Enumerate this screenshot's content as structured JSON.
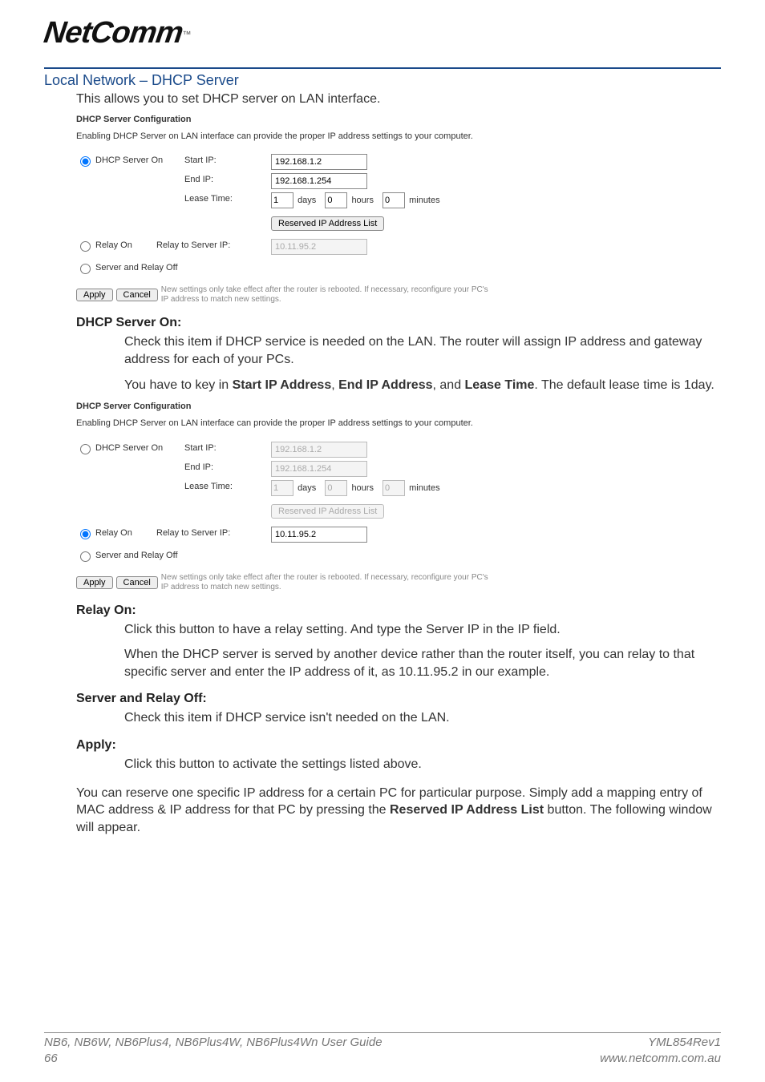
{
  "logo": {
    "brand": "NetComm",
    "tm": "™"
  },
  "section_title": "Local Network – DHCP Server",
  "intro": "This allows you to set DHCP server on LAN interface.",
  "panel1": {
    "title": "DHCP Server Configuration",
    "desc": "Enabling DHCP Server on LAN interface can provide the proper IP address settings to your computer.",
    "radio_dhcp_on": "DHCP Server On",
    "start_ip_label": "Start IP:",
    "start_ip": "192.168.1.2",
    "end_ip_label": "End IP:",
    "end_ip": "192.168.1.254",
    "lease_label": "Lease Time:",
    "days_val": "1",
    "days_lbl": "days",
    "hours_val": "0",
    "hours_lbl": "hours",
    "mins_val": "0",
    "mins_lbl": "minutes",
    "reserved_btn": "Reserved IP Address List",
    "radio_relay_on": "Relay On",
    "relay_ip_label": "Relay to Server IP:",
    "relay_ip": "10.11.95.2",
    "radio_off": "Server and Relay Off",
    "apply": "Apply",
    "cancel": "Cancel",
    "note": "New settings only take effect after the router is rebooted. If necessary, reconfigure your PC's IP address to match new settings."
  },
  "h_dhcp_on": "DHCP Server On:",
  "p_dhcp_on_1": "Check this item if DHCP service is needed on the LAN. The router will assign IP address and gateway address for each of your PCs.",
  "p_dhcp_on_2_pre": "You have to key in ",
  "p_dhcp_on_2_b1": "Start IP Address",
  "p_dhcp_on_2_mid1": ", ",
  "p_dhcp_on_2_b2": "End IP Address",
  "p_dhcp_on_2_mid2": ", and ",
  "p_dhcp_on_2_b3": "Lease Time",
  "p_dhcp_on_2_post": ". The default lease time is 1day.",
  "panel2": {
    "title": "DHCP Server Configuration",
    "desc": "Enabling DHCP Server on LAN interface can provide the proper IP address settings to your computer.",
    "radio_dhcp_on": "DHCP Server On",
    "start_ip_label": "Start IP:",
    "start_ip": "192.168.1.2",
    "end_ip_label": "End IP:",
    "end_ip": "192.168.1.254",
    "lease_label": "Lease Time:",
    "days_val": "1",
    "days_lbl": "days",
    "hours_val": "0",
    "hours_lbl": "hours",
    "mins_val": "0",
    "mins_lbl": "minutes",
    "reserved_btn": "Reserved IP Address List",
    "radio_relay_on": "Relay On",
    "relay_ip_label": "Relay to Server IP:",
    "relay_ip": "10.11.95.2",
    "radio_off": "Server and Relay Off",
    "apply": "Apply",
    "cancel": "Cancel",
    "note": "New settings only take effect after the router is rebooted. If necessary, reconfigure your PC's IP address to match new settings."
  },
  "h_relay_on": "Relay On:",
  "p_relay_on_1": "Click this button to have a relay setting. And type the Server IP in the IP field.",
  "p_relay_on_2": "When the DHCP server is served by another device rather than the router itself, you can relay to that specific server and enter the IP address of it, as 10.11.95.2 in our example.",
  "h_off": "Server and Relay Off:",
  "p_off": "Check this item if DHCP service isn't needed on the LAN.",
  "h_apply": "Apply:",
  "p_apply": "Click this button to activate the settings listed above.",
  "p_reserve_pre": "You can reserve one specific IP address for a certain PC for particular purpose. Simply add a mapping entry of MAC address & IP address for that PC by pressing the ",
  "p_reserve_b": "Reserved IP Address List",
  "p_reserve_post": " button. The following window will appear.",
  "footer": {
    "guide": "NB6, NB6W, NB6Plus4, NB6Plus4W, NB6Plus4Wn User Guide",
    "page": "66",
    "rev": "YML854Rev1",
    "url": "www.netcomm.com.au"
  }
}
